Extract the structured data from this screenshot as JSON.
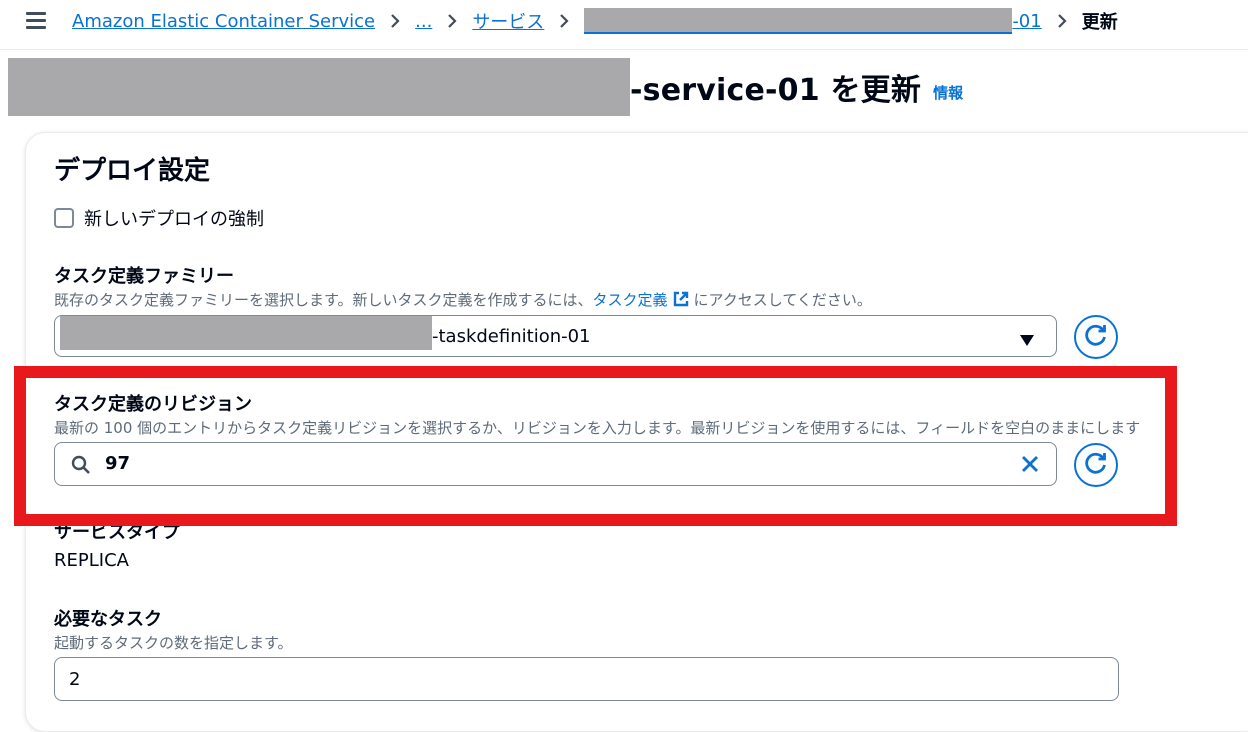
{
  "breadcrumb": {
    "items": [
      "Amazon Elastic Container Service",
      "...",
      "サービス"
    ],
    "service_suffix": "-01",
    "current": "更新"
  },
  "page": {
    "title_suffix": "-service-01 を更新",
    "info_label": "情報"
  },
  "deployment": {
    "section_title": "デプロイ設定",
    "force_checkbox_label": "新しいデプロイの強制",
    "force_checked": false,
    "family": {
      "label": "タスク定義ファミリー",
      "desc_before": "既存のタスク定義ファミリーを選択します。新しいタスク定義を作成するには、",
      "desc_link": "タスク定義",
      "desc_after": "にアクセスしてください。",
      "value_suffix": "-taskdefinition-01"
    },
    "revision": {
      "label": "タスク定義のリビジョン",
      "desc": "最新の 100 個のエントリからタスク定義リビジョンを選択するか、リビジョンを入力します。最新リビジョンを使用するには、フィールドを空白のままにします",
      "value": "97"
    },
    "service_type": {
      "label": "サービスタイプ",
      "value": "REPLICA"
    },
    "desired_tasks": {
      "label": "必要なタスク",
      "desc": "起動するタスクの数を指定します。",
      "value": "2"
    }
  },
  "colors": {
    "link": "#0972d3",
    "highlight": "#e8191c",
    "redaction": "#a9a9ac"
  }
}
